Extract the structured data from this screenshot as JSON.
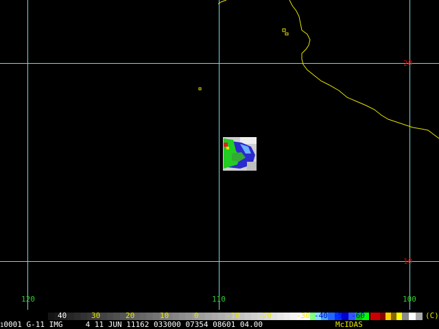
{
  "grid": {
    "lat_labels": [
      "20",
      "10"
    ],
    "lon_labels": [
      "120",
      "110",
      "100"
    ]
  },
  "colors": {
    "grid": "#7fd8d8",
    "coast": "#e6e600",
    "lat_label": "#d40000",
    "lon_label": "#33cc33",
    "scale_text_light": "#ffffff",
    "scale_text_yellow": "#e8e800"
  },
  "color_scale": {
    "labels": [
      "40",
      "30",
      "20",
      "10",
      "0",
      "-10",
      "-20",
      "-30",
      "-40",
      "-50",
      "-60"
    ],
    "copyright": "(C)"
  },
  "footer": {
    "frame": "1",
    "id": "0001",
    "satellite": "G-11",
    "type": "IMG",
    "band": "4",
    "date": "11 JUN 11162",
    "time": "033000",
    "line": "07354",
    "elem": "08601",
    "res": "04.00",
    "brand": "McIDAS"
  }
}
